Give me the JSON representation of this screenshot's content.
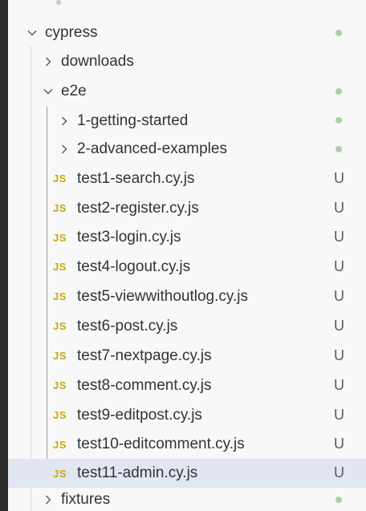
{
  "explorer": {
    "folders": {
      "cypress": {
        "label": "cypress",
        "status": "dot"
      },
      "downloads": {
        "label": "downloads"
      },
      "e2e": {
        "label": "e2e",
        "status": "dot"
      },
      "getting_started": {
        "label": "1-getting-started",
        "status": "dot"
      },
      "advanced_examples": {
        "label": "2-advanced-examples",
        "status": "dot"
      },
      "fixtures": {
        "label": "fixtures",
        "status": "dot"
      }
    },
    "js_badge": "JS",
    "untracked_badge": "U",
    "files": [
      {
        "label": "test1-search.cy.js",
        "status": "U"
      },
      {
        "label": "test2-register.cy.js",
        "status": "U"
      },
      {
        "label": "test3-login.cy.js",
        "status": "U"
      },
      {
        "label": "test4-logout.cy.js",
        "status": "U"
      },
      {
        "label": "test5-viewwithoutlog.cy.js",
        "status": "U"
      },
      {
        "label": "test6-post.cy.js",
        "status": "U"
      },
      {
        "label": "test7-nextpage.cy.js",
        "status": "U"
      },
      {
        "label": "test8-comment.cy.js",
        "status": "U"
      },
      {
        "label": "test9-editpost.cy.js",
        "status": "U"
      },
      {
        "label": "test10-editcomment.cy.js",
        "status": "U"
      },
      {
        "label": "test11-admin.cy.js",
        "status": "U",
        "selected": true
      }
    ],
    "colors": {
      "status_dot": "#a9cfa5",
      "js_icon": "#c8a90c",
      "selection": "#e2e5f2"
    }
  }
}
